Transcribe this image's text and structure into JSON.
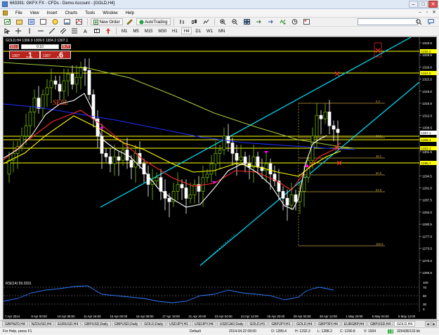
{
  "window": {
    "title": "663391: GKFX FX - CFDs - Demo Account - [GOLD,H4]",
    "buttons": {
      "minimize": "–",
      "maximize": "□",
      "close": "✕"
    }
  },
  "menu": {
    "items": [
      "File",
      "View",
      "Insert",
      "Charts",
      "Tools",
      "Window",
      "Help"
    ],
    "mdi_buttons": [
      "–",
      "▫",
      "✕"
    ]
  },
  "toolbar1": {
    "new_order": "New Order",
    "autotrading": "AutoTrading",
    "search_placeholder": ""
  },
  "toolbar2": {
    "timeframes": [
      "M1",
      "M5",
      "M15",
      "M30",
      "H1",
      "H4",
      "D1",
      "W1",
      "MN"
    ]
  },
  "chart": {
    "label": "GOLD,H4  1306.9 1309.0 1304.2 1307.1",
    "one_click": {
      "sell_label": "SELL",
      "buy_label": "BUY",
      "lot": "0.10",
      "sell_price_small": "1307",
      "sell_price_big": ".1",
      "buy_price_small": "1307",
      "buy_price_big": ".6"
    },
    "sell_annotation": "SELL",
    "price_axis": [
      "1333.0",
      "1329.5",
      "1326.0",
      "1322.5",
      "1319.0",
      "1315.5",
      "1312.0",
      "1308.5",
      "1305.0",
      "1301.5",
      "1298.0",
      "1294.5",
      "1291.0",
      "1287.5",
      "1284.0",
      "1280.5",
      "1277.0",
      "1273.5",
      "1270.0",
      "1266.5"
    ],
    "price_tags": [
      "1332.2",
      "1324.5",
      "1307.1",
      "1305.4",
      "1302.2",
      "1296.7"
    ],
    "fib_levels": [
      "0.0",
      "23.6",
      "38.2",
      "50.0",
      "61.8",
      "100.0"
    ],
    "colors": {
      "background": "#000000",
      "trendlines": "#00e5ff",
      "horizontal_lines": "#ffff00",
      "fib": "#c8a040",
      "bull_candle": "#7ec800",
      "bear_candle": "#ffffff",
      "ma_red": "#ff2a2a",
      "ma_yellow": "#ffff00",
      "ma_white": "#ffffff",
      "ma_olive": "#a9c93a",
      "ma_blue": "#1f2fff",
      "arrow_magenta": "#ff00ff",
      "arrow_red": "#ff3030"
    }
  },
  "rsi": {
    "label": "RSI(14) 59.3331",
    "levels": [
      "70",
      "50",
      "30"
    ],
    "axis": [
      "100",
      "0"
    ]
  },
  "date_axis": [
    "7 Apr 2014",
    "9 Apr 00:00",
    "10 Apr 08:00",
    "11 Apr 16:00",
    "15 Apr 00:00",
    "16 Apr 08:00",
    "17 Apr 16:00",
    "21 Apr 20:00",
    "23 Apr 04:00",
    "24 Apr 12:00",
    "25 Apr 20:00",
    "29 Apr 04:00",
    "30 Apr 12:00",
    "1 May 20:00",
    "5 May 04:00",
    "6 May 12:00"
  ],
  "tabs": [
    "GBPNZD,H4",
    "NZDUSD,H4",
    "EURUSD,H4",
    "GBPUSD,Daily",
    "GBPUSD,Daily",
    "GOLD,Daily",
    "USDJPY,H1",
    "USDJPY,H4",
    "USDCAD,Daily",
    "GOLD,H1",
    "GBPJPY,H1",
    "GOLD,H4",
    "GBPTRY,H4",
    "EURGBP,H4",
    "GBPUSD,H4",
    "GOLD,H4"
  ],
  "active_tab": "GOLD,H4",
  "tab_arrows": [
    "◄",
    "►"
  ],
  "status": {
    "help": "For Help, press F1",
    "profile": "Default",
    "datetime": "2014.04.22 08:00",
    "open": "O: 1289.4",
    "high": "H: 1292.3",
    "low": "L: 1288.2",
    "close": "C: 1290.8",
    "volume": "V: 1934",
    "traffic": "329438/133 kb"
  }
}
